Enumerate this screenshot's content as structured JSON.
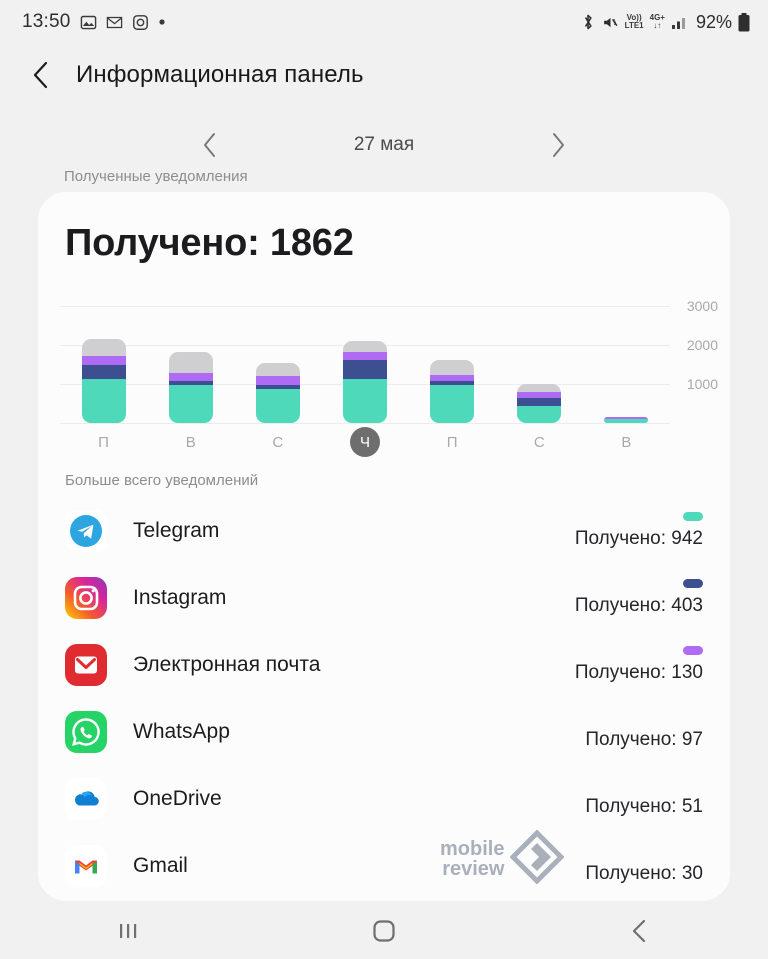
{
  "status_bar": {
    "time": "13:50",
    "icons_left": [
      "gallery-icon",
      "gmail-icon",
      "instagram-icon",
      "dot-icon"
    ],
    "icons_right": [
      "bluetooth-icon",
      "mute-icon",
      "volte-icon",
      "network-4g-icon",
      "signal-icon"
    ],
    "volte_top": "Vo))",
    "volte_bottom": "LTE1",
    "network_top": "4G+",
    "network_bottom": "↓↑",
    "battery": "92%"
  },
  "app_bar": {
    "back_icon": "back-chevron-icon",
    "title": "Информационная панель"
  },
  "date_nav": {
    "prev_icon": "chevron-left-icon",
    "label": "27 мая",
    "next_icon": "chevron-right-icon"
  },
  "sections": {
    "received_label": "Полученные уведомления",
    "most_label": "Больше всего уведомлений"
  },
  "card": {
    "title": "Получено: 1862"
  },
  "chart_data": {
    "type": "bar",
    "title": "Получено: 1862",
    "xlabel": "",
    "ylabel": "",
    "grid": true,
    "stacked": true,
    "ylim": [
      0,
      3300
    ],
    "yticks": [
      1000,
      2000,
      3000
    ],
    "ytick_labels": [
      "1000",
      "2000",
      "3000"
    ],
    "categories": [
      "П",
      "В",
      "С",
      "Ч",
      "П",
      "С",
      "В"
    ],
    "selected_category_index": 3,
    "series": [
      {
        "name": "Telegram",
        "color": "#4fd9bb",
        "values": [
          1130,
          960,
          870,
          1130,
          960,
          440,
          90
        ]
      },
      {
        "name": "Instagram",
        "color": "#3c5091",
        "values": [
          360,
          110,
          90,
          480,
          110,
          190,
          0
        ]
      },
      {
        "name": "Email",
        "color": "#b06bf5",
        "values": [
          220,
          200,
          250,
          200,
          170,
          160,
          60
        ]
      },
      {
        "name": "Other",
        "color": "#cfcfd1",
        "values": [
          430,
          550,
          320,
          300,
          360,
          200,
          0
        ]
      }
    ],
    "totals": [
      2140,
      1820,
      1530,
      2110,
      1600,
      990,
      150
    ]
  },
  "apps": [
    {
      "name": "Telegram",
      "icon": "telegram-icon",
      "count": "Получено: 942",
      "dot_color": "#4fd9bb",
      "show_dot": true
    },
    {
      "name": "Instagram",
      "icon": "instagram-icon",
      "count": "Получено: 403",
      "dot_color": "#3c5091",
      "show_dot": true
    },
    {
      "name": "Электронная почта",
      "icon": "email-icon",
      "count": "Получено: 130",
      "dot_color": "#b06bf5",
      "show_dot": true
    },
    {
      "name": "WhatsApp",
      "icon": "whatsapp-icon",
      "count": "Получено: 97",
      "dot_color": "#cfcfd1",
      "show_dot": false
    },
    {
      "name": "OneDrive",
      "icon": "onedrive-icon",
      "count": "Получено: 51",
      "dot_color": "#cfcfd1",
      "show_dot": false
    },
    {
      "name": "Gmail",
      "icon": "gmail-icon",
      "count": "Получено: 30",
      "dot_color": "#cfcfd1",
      "show_dot": false
    }
  ],
  "watermark": {
    "line1": "mobile",
    "line2": "review"
  },
  "nav_bar": {
    "recents": "recents-icon",
    "home": "home-icon",
    "back": "back-icon"
  },
  "colors": {
    "background": "#f1f1f1",
    "card": "#fcfcfc",
    "accent_teal": "#4fd9bb",
    "accent_blue": "#3c5091",
    "accent_purple": "#b06bf5",
    "accent_gray": "#cfcfd1",
    "selected_day": "#6e6e6e"
  }
}
